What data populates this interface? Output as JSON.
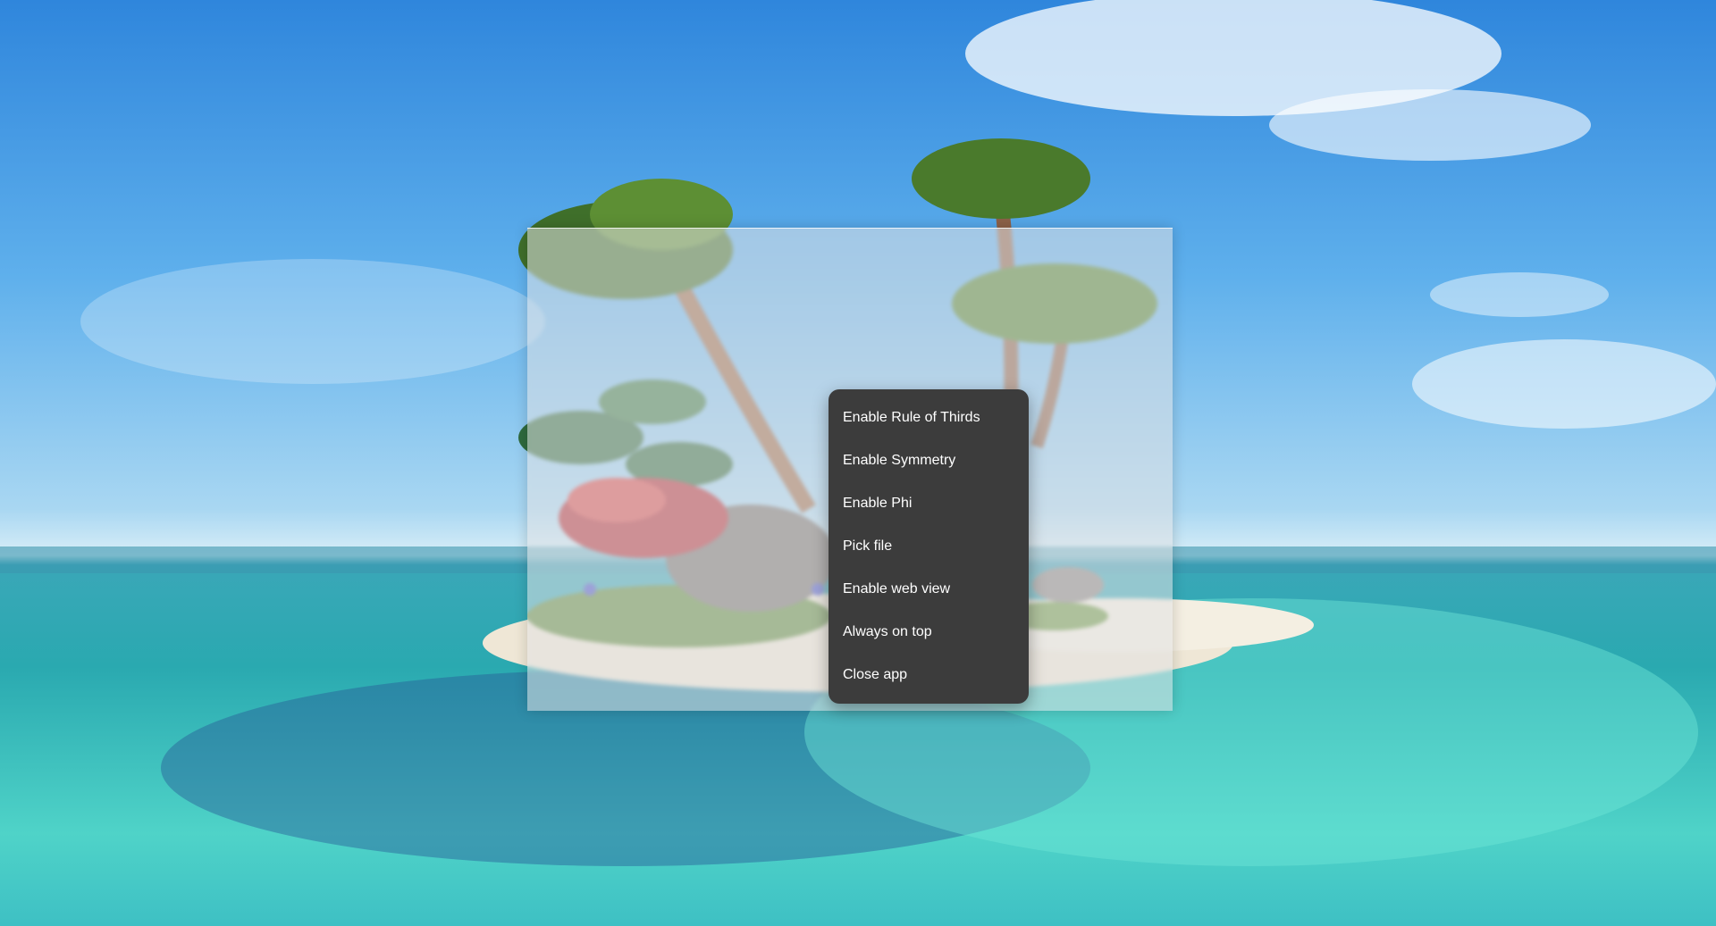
{
  "window": {
    "title": ""
  },
  "context_menu": {
    "items": [
      {
        "label": "Enable Rule of Thirds"
      },
      {
        "label": "Enable Symmetry"
      },
      {
        "label": "Enable Phi"
      },
      {
        "label": "Pick file"
      },
      {
        "label": "Enable web view"
      },
      {
        "label": "Always on top"
      },
      {
        "label": "Close app"
      }
    ]
  },
  "colors": {
    "menu_background": "#3c3c3c",
    "menu_text": "#ffffff",
    "sky": "#5fb0ec",
    "sea": "#2aa9b0"
  }
}
